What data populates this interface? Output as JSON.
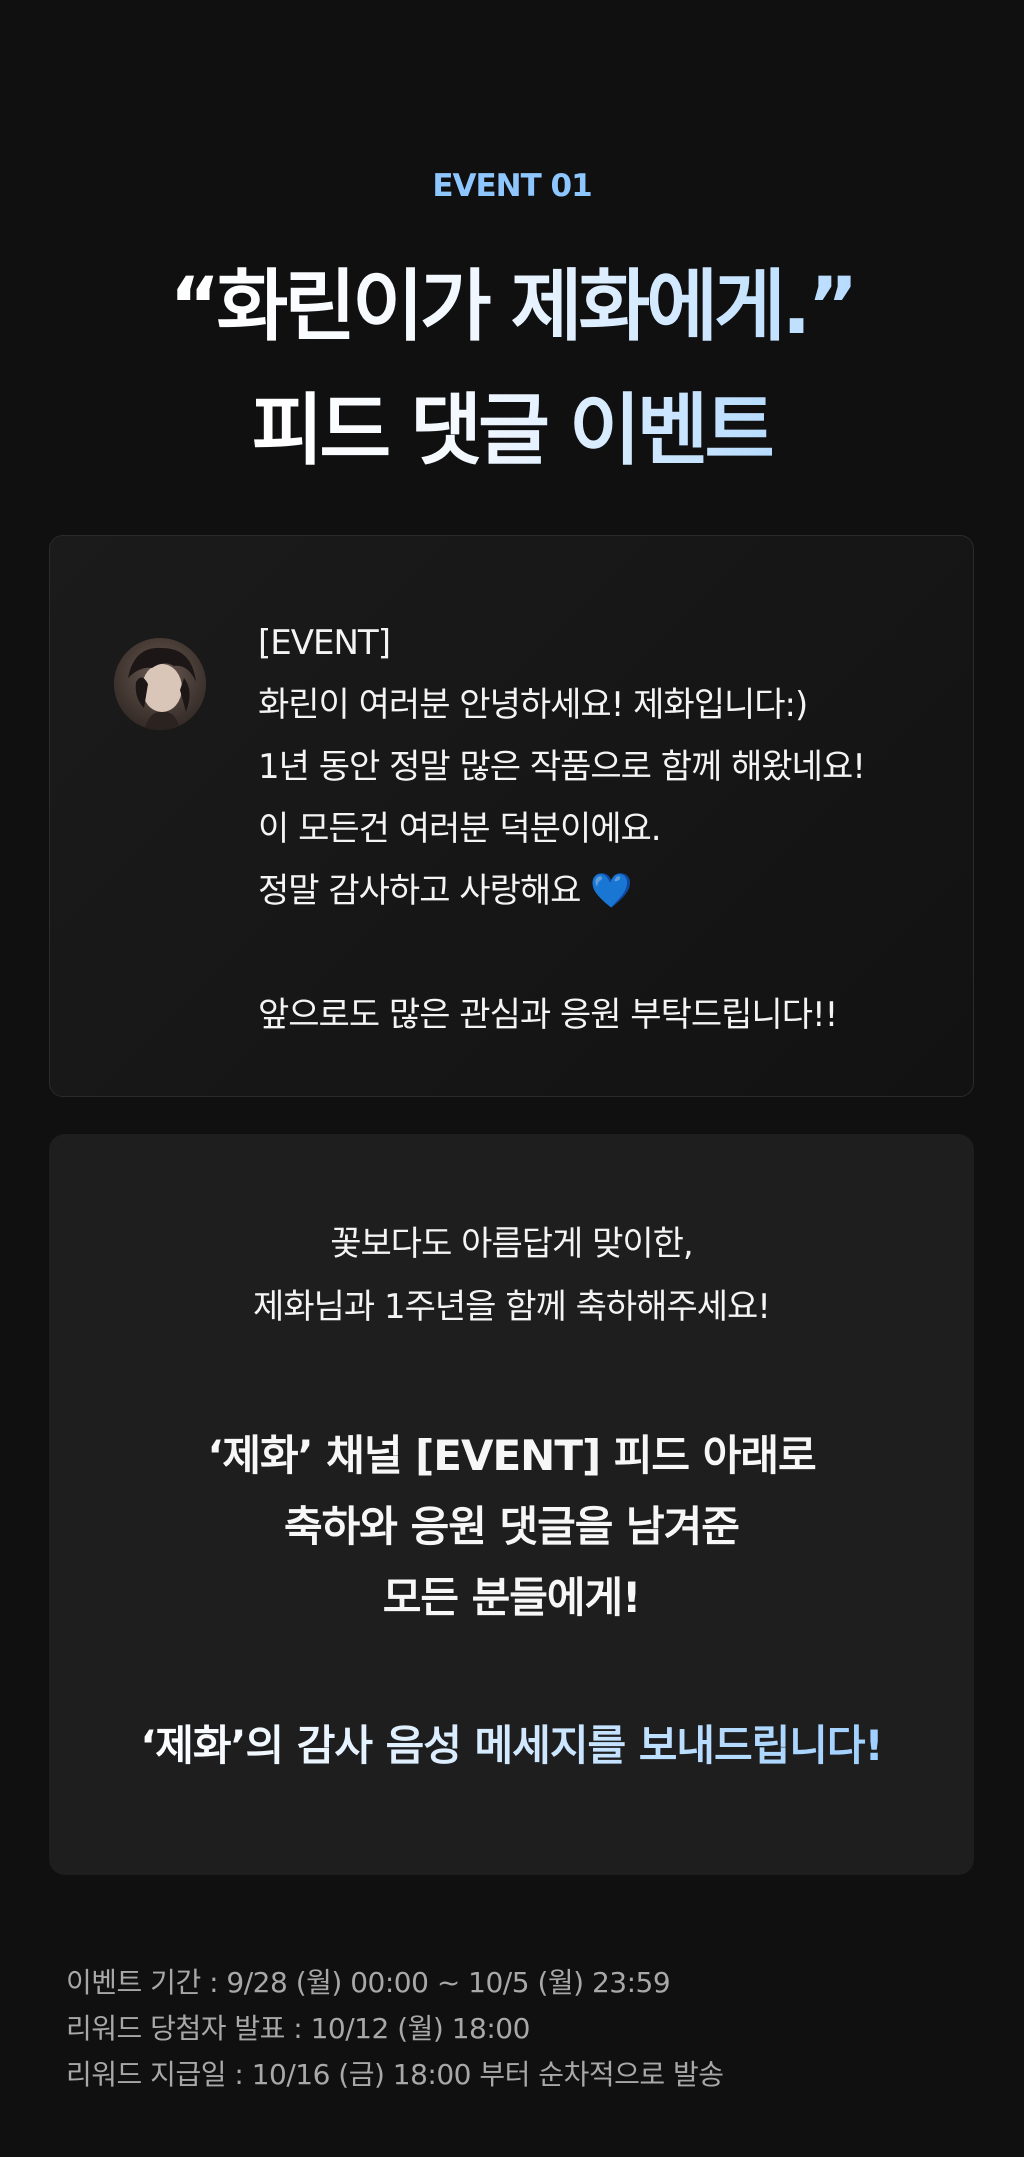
{
  "event_label": "EVENT 01",
  "headline": {
    "line1": "“화린이가 제화에게.”",
    "line2": "피드 댓글 이벤트"
  },
  "message": {
    "lines": [
      "[EVENT]",
      "화린이 여러분 안녕하세요! 제화입니다:)",
      "1년 동안 정말 많은 작품으로 함께 해왔네요!",
      "이 모든건 여러분 덕분이에요.",
      "정말 감사하고 사랑해요",
      "앞으로도 많은 관심과 응원 부탁드립니다!!"
    ],
    "heart": "💙"
  },
  "event_card": {
    "intro1": "꽃보다도 아름답게 맞이한,",
    "intro2": "제화님과 1주년을 함께 축하해주세요!",
    "bold1": "‘제화’ 채널 [EVENT] 피드 아래로",
    "bold2": "축하와 응원 댓글을 남겨준",
    "bold3": "모든 분들에게!",
    "voice": "‘제화’의 감사 음성 메세지를 보내드립니다!"
  },
  "info": {
    "period": "이벤트 기간 : 9/28 (월) 00:00 ~ 10/5 (월) 23:59",
    "announce": "리워드 당첨자 발표 : 10/12 (월) 18:00",
    "payout": "리워드 지급일 : 10/16 (금) 18:00 부터 순차적으로 발송"
  }
}
